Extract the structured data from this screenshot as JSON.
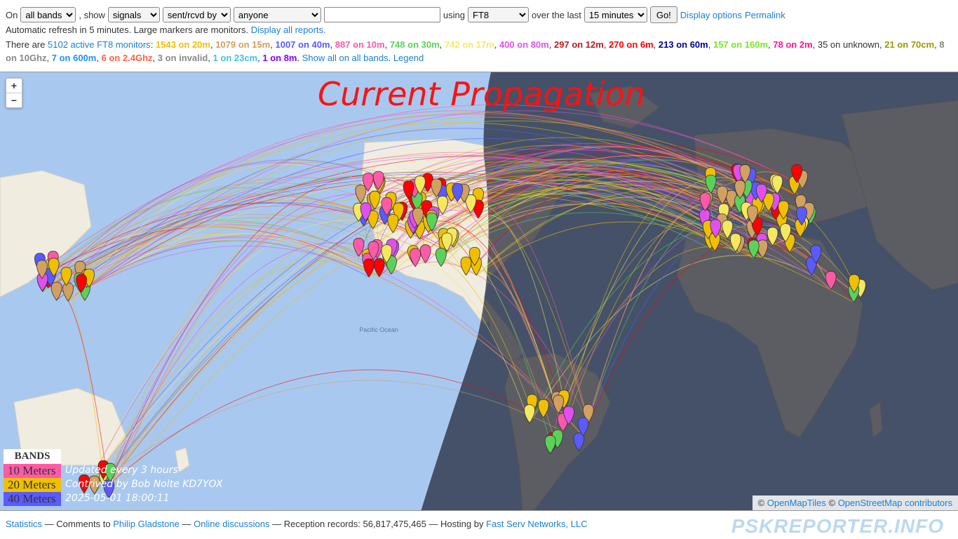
{
  "controls": {
    "on_label": "On",
    "band_select": "all bands",
    "show_label": ", show",
    "show_select": "signals",
    "direction_select": "sent/rcvd by",
    "who_select": "anyone",
    "callsign_value": "",
    "using_label": "using",
    "mode_select": "FT8",
    "over_label": "over the last",
    "period_select": "15 minutes",
    "go_label": "Go!",
    "display_options": "Display options",
    "permalink": "Permalink"
  },
  "refresh": {
    "text": "Automatic refresh in 5 minutes. Large markers are monitors.",
    "link": "Display all reports."
  },
  "stats": {
    "prefix": "There are",
    "monitors_link": "5102 active FT8 monitors",
    "bands": [
      {
        "text": "1543 on 20m",
        "color": "#f0c000"
      },
      {
        "text": "1079 on 15m",
        "color": "#d2a060"
      },
      {
        "text": "1007 on 40m",
        "color": "#5a5aff"
      },
      {
        "text": "887 on 10m",
        "color": "#ff5aa8"
      },
      {
        "text": "748 on 30m",
        "color": "#5ad25a"
      },
      {
        "text": "742 on 17m",
        "color": "#f5e860"
      },
      {
        "text": "400 on 80m",
        "color": "#e050f0"
      },
      {
        "text": "297 on 12m",
        "color": "#b41e1e"
      },
      {
        "text": "270 on 6m",
        "color": "#ff0000"
      },
      {
        "text": "213 on 60m",
        "color": "#00008c"
      },
      {
        "text": "157 on 160m",
        "color": "#78e628"
      },
      {
        "text": "78 on 2m",
        "color": "#ff1493"
      },
      {
        "text": "35 on unknown",
        "color": "#333333",
        "plain": true
      },
      {
        "text": "21 on 70cm",
        "color": "#999900"
      },
      {
        "text": "8 on 10Ghz",
        "color": "#888888"
      },
      {
        "text": "7 on 600m",
        "color": "#1e90ff"
      },
      {
        "text": "6 on 2.4Ghz",
        "color": "#ff6040"
      },
      {
        "text": "3 on invalid",
        "color": "#888888"
      },
      {
        "text": "1 on 23cm",
        "color": "#40c0e0"
      },
      {
        "text": "1 on 8m",
        "color": "#7f00ff"
      }
    ],
    "show_all": "Show all on all bands",
    "legend_link": "Legend"
  },
  "map": {
    "zoom_in": "+",
    "zoom_out": "−",
    "overlay_title": "Current Propagation",
    "legend_header": "BANDS",
    "legend_items": [
      {
        "label": "10 Meters",
        "color": "#ff5aa8"
      },
      {
        "label": "20 Meters",
        "color": "#f0c000"
      },
      {
        "label": "40 Meters",
        "color": "#5a5aff"
      }
    ],
    "credit_lines": [
      "Updated every 3 hours",
      "Contrived by Bob Nolte KD7YOX",
      "2025-05-01  18:00:11"
    ],
    "attribution_a": "OpenMapTiles",
    "attribution_b": "OpenStreetMap contributors",
    "copyright": "©",
    "ocean_labels": [
      "Pacific Ocean"
    ]
  },
  "footer": {
    "statistics": "Statistics",
    "sep1": "— Comments to",
    "philip": "Philip Gladstone",
    "sep2": "—",
    "discussions": "Online discussions",
    "records": "— Reception records: 56,817,475,465 — Hosting by",
    "hosting": "Fast Serv Networks, LLC",
    "brand": "PSKREPORTER.INFO"
  }
}
